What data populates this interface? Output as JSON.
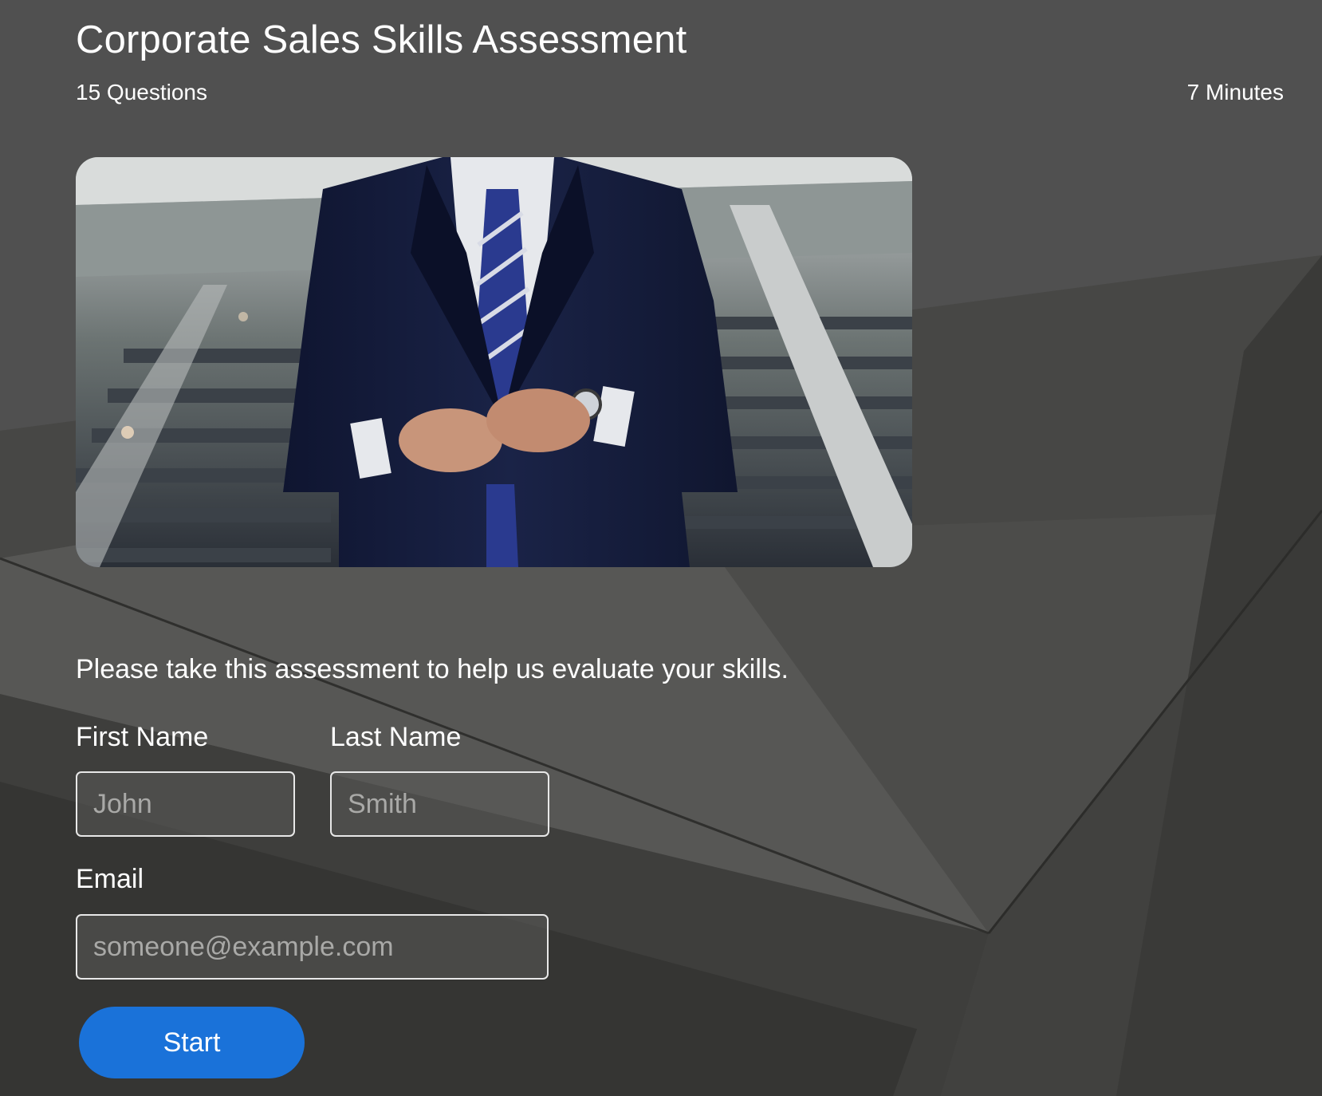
{
  "header": {
    "title": "Corporate Sales Skills Assessment",
    "question_count": "15 Questions",
    "duration": "7 Minutes"
  },
  "hero_image": {
    "subject": "man in navy suit buttoning jacket on staircase"
  },
  "form": {
    "intro": "Please take this assessment to help us evaluate your skills.",
    "first_name": {
      "label": "First Name",
      "placeholder": "John",
      "value": ""
    },
    "last_name": {
      "label": "Last Name",
      "placeholder": "Smith",
      "value": ""
    },
    "email": {
      "label": "Email",
      "placeholder": "someone@example.com",
      "value": ""
    },
    "start_label": "Start"
  },
  "colors": {
    "background": "#4a4a48",
    "button": "#1a72d9",
    "text": "#ffffff"
  }
}
